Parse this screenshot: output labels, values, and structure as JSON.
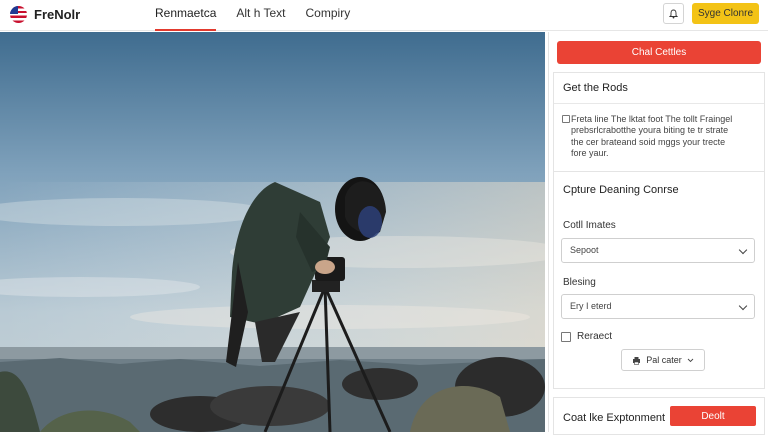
{
  "header": {
    "logo_text": "FreNolr",
    "nav": [
      {
        "label": "Renmaetca",
        "active": true
      },
      {
        "label": "Alt h Text",
        "active": false
      },
      {
        "label": "Compiry",
        "active": false
      }
    ],
    "cta_label": "Syge Clonre",
    "accent_color": "#e23a2e",
    "cta_color": "#f3c316",
    "bell_icon": "bell-icon"
  },
  "sidebar": {
    "top_button": "Chal Cettles",
    "section1_title": "Get the Rods",
    "description": "Freta line The lktat foot The tollt Fraingel prebsrlcrabotthe youra biting te tr strate the cer brateand soid mggs your trecte fore yaur.",
    "section2_title": "Cpture Deaning Conrse",
    "field1_label": "Cotll Imates",
    "field1_value": "Sepoot",
    "field2_label": "Blesing",
    "field2_value": "Ery I eterd",
    "checkbox_label": "Reraect",
    "sub_button": "Pal cater",
    "bottom_label": "Coat lke Exptonment",
    "bottom_button": "Deolt",
    "button_color": "#ea4335"
  }
}
